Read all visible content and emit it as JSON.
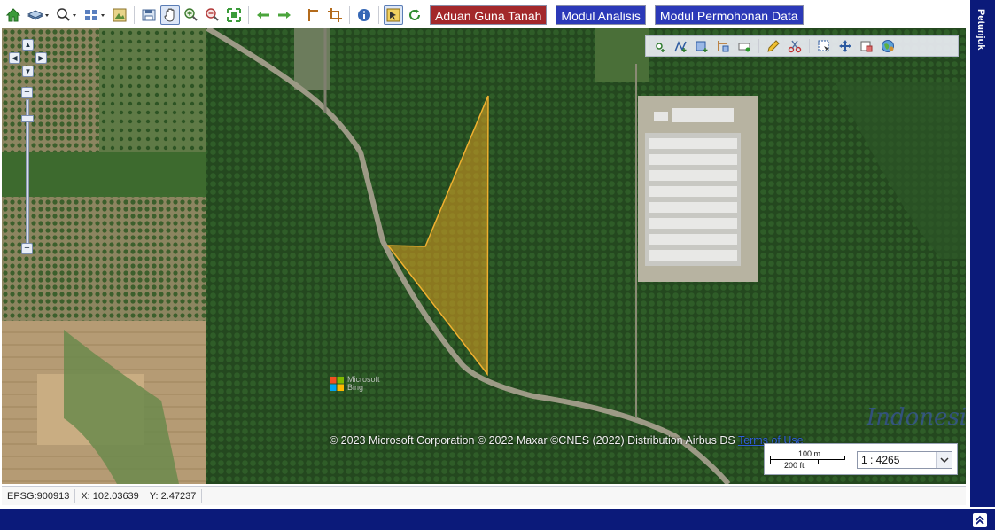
{
  "toolbar": {
    "icons": [
      "home-icon",
      "layers-icon",
      "zoom-search-icon",
      "grid-view-icon",
      "map-image-icon",
      "save-map-icon",
      "pan-hand-icon",
      "zoom-in-icon",
      "zoom-out-icon",
      "full-extent-icon",
      "previous-extent-icon",
      "next-extent-icon",
      "measure-icon",
      "crop-icon",
      "info-icon",
      "select-feature-icon",
      "refresh-icon"
    ],
    "buttons": {
      "aduan": "Aduan Guna Tanah",
      "analisis": "Modul Analisis",
      "permohonan": "Modul Permohonan Data"
    },
    "colors": {
      "red_button": "#a3282b",
      "blue_button": "#2b39b8"
    }
  },
  "map": {
    "attribution": "© 2023 Microsoft Corporation © 2022 Maxar ©CNES (2022) Distribution Airbus DS",
    "terms_link": "Terms of Use",
    "bing_logo_line1": "Microsoft",
    "bing_logo_line2": "Bing",
    "watermark": "Indonesia",
    "polygon_fill": "#e0a020",
    "edit_tools": [
      "add-point-icon",
      "add-line-icon",
      "add-polygon-icon",
      "edit-vertex-icon",
      "delete-feature-icon",
      "draw-pencil-icon",
      "cut-scissors-icon",
      "select-box-icon",
      "move-icon",
      "erase-icon",
      "globe-icon"
    ]
  },
  "scale": {
    "top_label": "100 m",
    "bottom_label": "200 ft",
    "ratio": "1 : 4265"
  },
  "status": {
    "crs": "EPSG:900913",
    "x": "X: 102.03639",
    "y": "Y: 2.47237"
  },
  "side_panel": {
    "label": "Petunjuk"
  }
}
